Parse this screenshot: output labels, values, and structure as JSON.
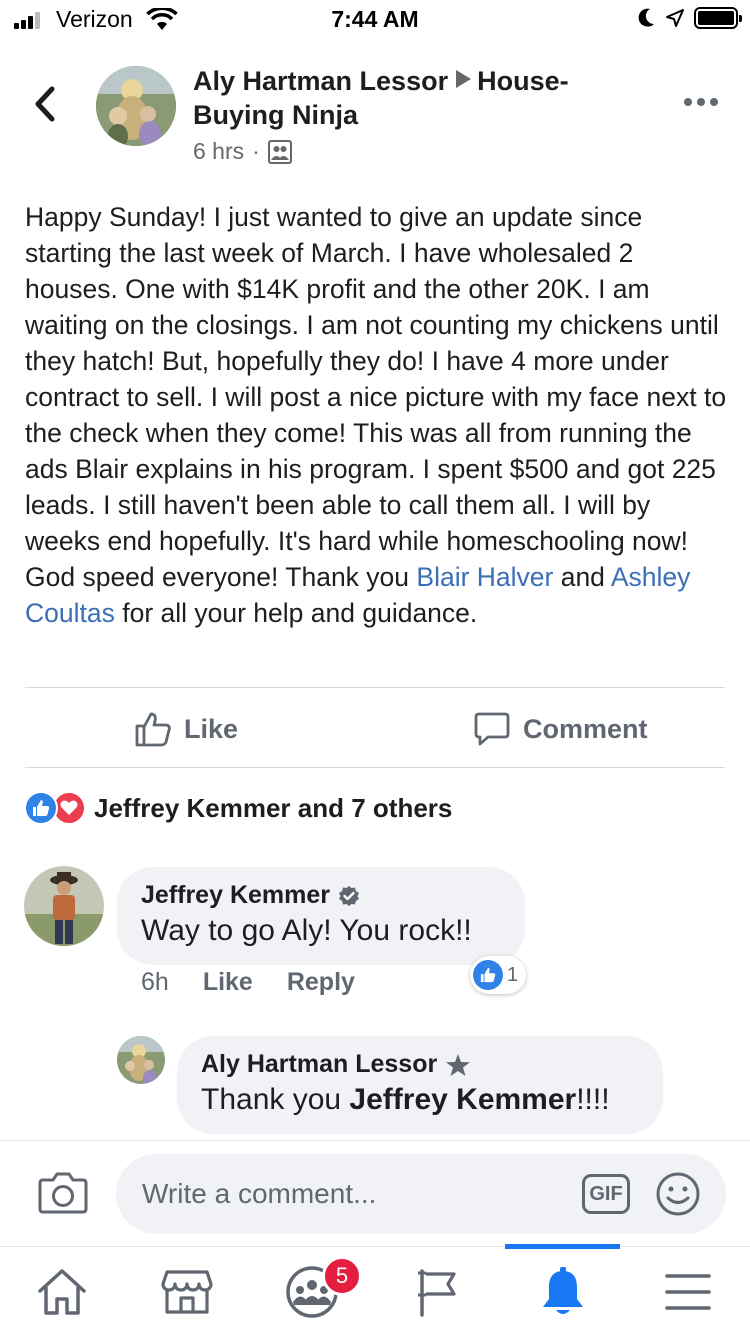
{
  "status_bar": {
    "carrier": "Verizon",
    "time": "7:44 AM"
  },
  "post": {
    "author": "Aly Hartman Lessor",
    "group": "House-Buying Ninja",
    "time": "6 hrs",
    "dot": "·",
    "text_before": "Happy Sunday!  I just wanted to give an update since starting the last week of March.  I have wholesaled 2 houses.  One with $14K profit and the other 20K.  I am waiting on the closings.  I am not counting my chickens until they hatch!  But, hopefully they do!  I have 4 more under contract to sell.  I will post a nice picture with my face next to the check when they come!  This was all from running the ads Blair explains in his program.  I spent $500 and got 225 leads.  I still haven't been able to call them all.  I will by weeks end hopefully.  It's hard while homeschooling now!  God speed everyone!  Thank you ",
    "mention_1": "Blair Halver",
    "text_and": " and ",
    "mention_2": "Ashley Coultas",
    "text_after": " for all your help and guidance."
  },
  "actions": {
    "like": "Like",
    "comment": "Comment"
  },
  "reactions_summary": "Jeffrey Kemmer and 7 others",
  "comments": [
    {
      "name": "Jeffrey Kemmer",
      "text": "Way to go Aly! You rock!!",
      "time": "6h",
      "like_label": "Like",
      "reply_label": "Reply",
      "reaction_count": "1"
    }
  ],
  "reply": {
    "name": "Aly Hartman Lessor",
    "text_prefix": "Thank you ",
    "text_mention": "Jeffrey Kemmer",
    "text_suffix": "!!!!"
  },
  "composer": {
    "placeholder": "Write a comment...",
    "gif_label": "GIF"
  },
  "nav": {
    "groups_badge": "5"
  },
  "colors": {
    "link": "#3b6fb6",
    "like_blue": "#2e82e8",
    "love_red": "#ec3e4d",
    "nav_active": "#1877f2",
    "badge_red": "#e41e3f"
  },
  "icons": [
    "back-arrow-icon",
    "more-options-icon",
    "group-audience-icon",
    "like-thumb-icon",
    "comment-bubble-icon",
    "verified-badge-icon",
    "star-badge-icon",
    "camera-icon",
    "emoji-icon",
    "home-icon",
    "marketplace-icon",
    "groups-icon",
    "pages-flag-icon",
    "notifications-bell-icon",
    "menu-icon"
  ]
}
